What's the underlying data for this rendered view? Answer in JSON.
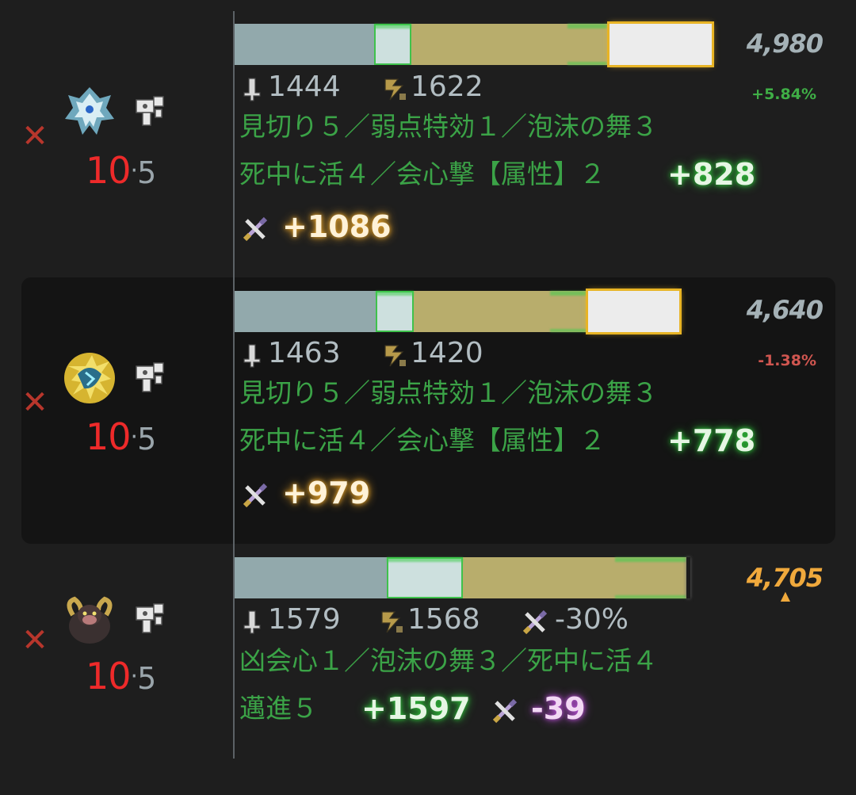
{
  "close_glyph": "✕",
  "rank_dot": "·",
  "cards": [
    {
      "monster_icon": "velkhana-icon",
      "weapon_icon": "bowgun-icon",
      "rank": "10",
      "subrank": "5",
      "total": "4,980",
      "percent": "+5.84%",
      "bar_segments": {
        "raw": 0.345,
        "crit": 0.092,
        "element": 0.49,
        "element_crit": 0.27
      },
      "raw_value": "1444",
      "crit_value": "1622",
      "skills_line1": "見切り５／弱点特効１／泡沫の舞３",
      "skills_line2": "死中に活４／会心撃【属性】２",
      "crit_bonus": "+828",
      "element_bonus": "+1086"
    },
    {
      "monster_icon": "zinogre-icon",
      "weapon_icon": "bowgun-icon",
      "rank": "10",
      "subrank": "5",
      "total": "4,640",
      "percent": "-1.38%",
      "bar_segments": {
        "raw": 0.349,
        "crit": 0.094,
        "element": 0.43,
        "element_crit": 0.235
      },
      "raw_value": "1463",
      "crit_value": "1420",
      "skills_line1": "見切り５／弱点特効１／泡沫の舞３",
      "skills_line2": "死中に活４／会心撃【属性】２",
      "crit_bonus": "+778",
      "element_bonus": "+979"
    },
    {
      "monster_icon": "rajang-icon",
      "weapon_icon": "bowgun-icon",
      "rank": "10",
      "subrank": "5",
      "total": "4,705",
      "best_marker": "▲",
      "bar_segments": {
        "raw": 0.375,
        "crit": 0.19,
        "element": 0.55
      },
      "raw_value": "1579",
      "crit_value": "1568",
      "element_modifier": "-30%",
      "skills_line1": "凶会心１／泡沫の舞３／死中に活４",
      "skills_line2": "邁進５",
      "crit_bonus": "+1597",
      "element_bonus": "-39"
    }
  ],
  "colors": {
    "raw_bar": "#92a9ac",
    "crit_bar": "#cde0de",
    "element_bar": "#b8ad6c",
    "element_crit_bar": "#ececec",
    "best_total": "#f0a93c",
    "skill_text": "#3ba347",
    "rank_red": "#ee2a2a",
    "positive": "#3fae46",
    "negative": "#d05650"
  }
}
